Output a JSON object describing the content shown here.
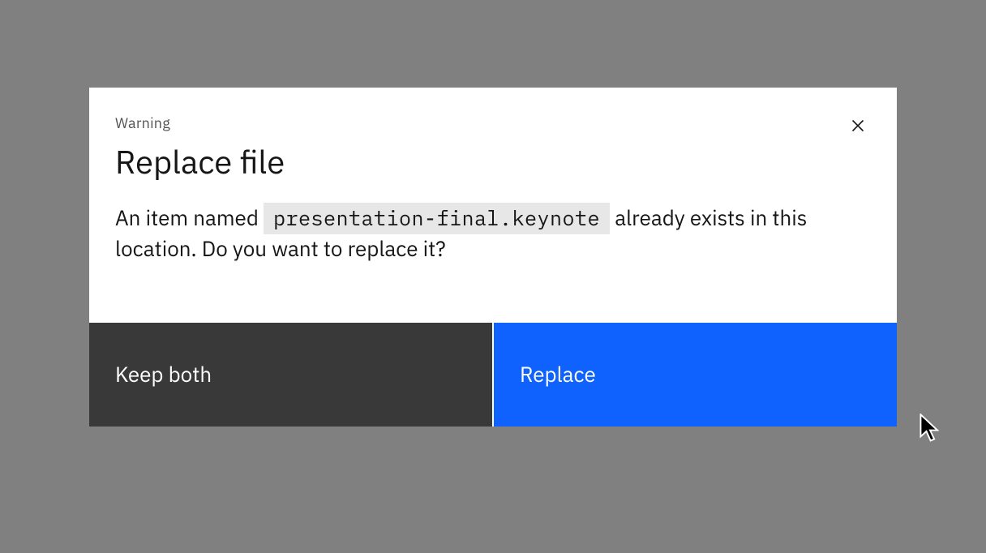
{
  "modal": {
    "label": "Warning",
    "title": "Replace file",
    "body_prefix": "An item named ",
    "filename": "presentation-final.keynote",
    "body_suffix": " already exists in this location. Do you want to replace it?"
  },
  "buttons": {
    "secondary": "Keep both",
    "primary": "Replace"
  }
}
